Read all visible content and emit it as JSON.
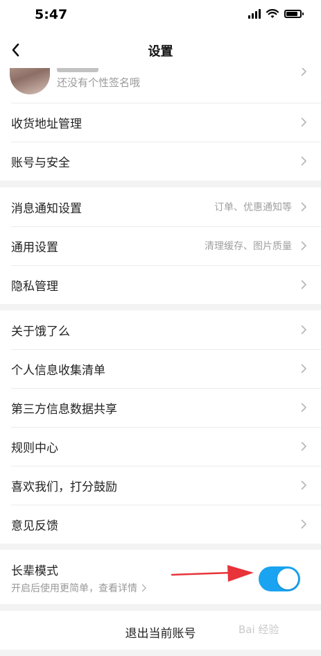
{
  "status_bar": {
    "time": "5:47"
  },
  "nav": {
    "title": "设置"
  },
  "profile": {
    "signature": "还没有个性签名哦"
  },
  "group1": [
    {
      "label": "收货地址管理"
    },
    {
      "label": "账号与安全"
    }
  ],
  "group2": [
    {
      "label": "消息通知设置",
      "sub": "订单、优惠通知等"
    },
    {
      "label": "通用设置",
      "sub": "清理缓存、图片质量"
    },
    {
      "label": "隐私管理",
      "sub": ""
    }
  ],
  "group3": [
    {
      "label": "关于饿了么"
    },
    {
      "label": "个人信息收集清单"
    },
    {
      "label": "第三方信息数据共享"
    },
    {
      "label": "规则中心"
    },
    {
      "label": "喜欢我们，打分鼓励"
    },
    {
      "label": "意见反馈"
    }
  ],
  "elder_mode": {
    "title": "长辈模式",
    "description": "开启后使用更简单，查看详情",
    "enabled": true
  },
  "logout_label": "退出当前账号",
  "watermark": "Bai 经验",
  "colors": {
    "toggle_on": "#1aa3f0",
    "arrow": "#e8333a"
  }
}
